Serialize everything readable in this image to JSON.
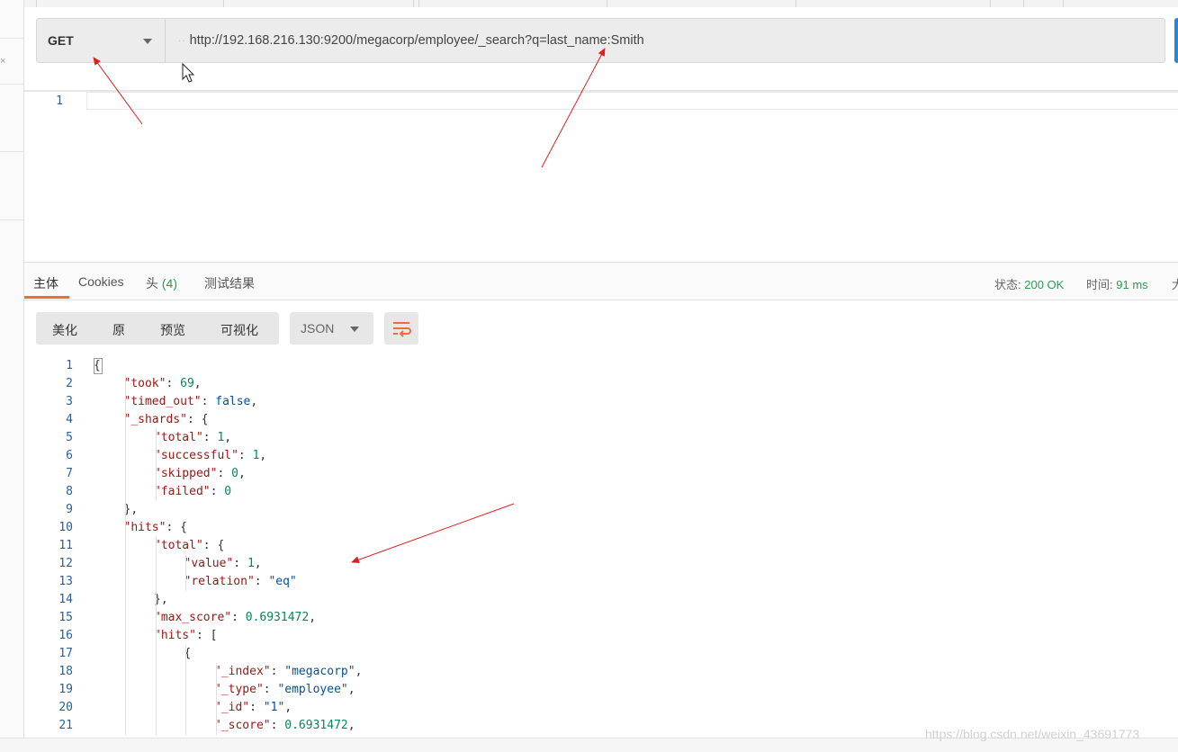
{
  "request": {
    "method": "GET",
    "url": "http://192.168.216.130:9200/megacorp/employee/_search?q=last_name:Smith"
  },
  "editor": {
    "line_numbers": [
      "1"
    ]
  },
  "response_tabs": {
    "body": "主体",
    "cookies": "Cookies",
    "headers": "头",
    "headers_count": "(4)",
    "tests": "测试结果"
  },
  "status": {
    "status_label": "状态:",
    "status_value": "200 OK",
    "time_label": "时间:",
    "time_value": "91 ms",
    "size_label": "大"
  },
  "format_toolbar": {
    "pretty": "美化",
    "raw": "原",
    "preview": "预览",
    "visualize": "可视化",
    "language": "JSON"
  },
  "code_lines": [
    {
      "n": "1",
      "indent": 0,
      "parts": [
        [
          "p",
          "{"
        ]
      ]
    },
    {
      "n": "2",
      "indent": 1,
      "parts": [
        [
          "k",
          "\"took\""
        ],
        [
          "p",
          ": "
        ],
        [
          "n",
          "69"
        ],
        [
          "p",
          ","
        ]
      ]
    },
    {
      "n": "3",
      "indent": 1,
      "parts": [
        [
          "k",
          "\"timed_out\""
        ],
        [
          "p",
          ": "
        ],
        [
          "b",
          "false"
        ],
        [
          "p",
          ","
        ]
      ]
    },
    {
      "n": "4",
      "indent": 1,
      "parts": [
        [
          "k",
          "\"_shards\""
        ],
        [
          "p",
          ": {"
        ]
      ]
    },
    {
      "n": "5",
      "indent": 2,
      "parts": [
        [
          "k",
          "\"total\""
        ],
        [
          "p",
          ": "
        ],
        [
          "n",
          "1"
        ],
        [
          "p",
          ","
        ]
      ]
    },
    {
      "n": "6",
      "indent": 2,
      "parts": [
        [
          "k",
          "\"successful\""
        ],
        [
          "p",
          ": "
        ],
        [
          "n",
          "1"
        ],
        [
          "p",
          ","
        ]
      ]
    },
    {
      "n": "7",
      "indent": 2,
      "parts": [
        [
          "k",
          "\"skipped\""
        ],
        [
          "p",
          ": "
        ],
        [
          "n",
          "0"
        ],
        [
          "p",
          ","
        ]
      ]
    },
    {
      "n": "8",
      "indent": 2,
      "parts": [
        [
          "k",
          "\"failed\""
        ],
        [
          "p",
          ": "
        ],
        [
          "n",
          "0"
        ]
      ]
    },
    {
      "n": "9",
      "indent": 1,
      "parts": [
        [
          "p",
          "},"
        ]
      ]
    },
    {
      "n": "10",
      "indent": 1,
      "parts": [
        [
          "k",
          "\"hits\""
        ],
        [
          "p",
          ": {"
        ]
      ]
    },
    {
      "n": "11",
      "indent": 2,
      "parts": [
        [
          "k",
          "\"total\""
        ],
        [
          "p",
          ": {"
        ]
      ]
    },
    {
      "n": "12",
      "indent": 3,
      "parts": [
        [
          "k",
          "\"value\""
        ],
        [
          "p",
          ": "
        ],
        [
          "n",
          "1"
        ],
        [
          "p",
          ","
        ]
      ]
    },
    {
      "n": "13",
      "indent": 3,
      "parts": [
        [
          "k",
          "\"relation\""
        ],
        [
          "p",
          ": "
        ],
        [
          "s",
          "\"eq\""
        ]
      ]
    },
    {
      "n": "14",
      "indent": 2,
      "parts": [
        [
          "p",
          "},"
        ]
      ]
    },
    {
      "n": "15",
      "indent": 2,
      "parts": [
        [
          "k",
          "\"max_score\""
        ],
        [
          "p",
          ": "
        ],
        [
          "n",
          "0.6931472"
        ],
        [
          "p",
          ","
        ]
      ]
    },
    {
      "n": "16",
      "indent": 2,
      "parts": [
        [
          "k",
          "\"hits\""
        ],
        [
          "p",
          ": ["
        ]
      ]
    },
    {
      "n": "17",
      "indent": 3,
      "parts": [
        [
          "p",
          "{"
        ]
      ]
    },
    {
      "n": "18",
      "indent": 4,
      "parts": [
        [
          "k",
          "\"_index\""
        ],
        [
          "p",
          ": "
        ],
        [
          "s",
          "\"megacorp\""
        ],
        [
          "p",
          ","
        ]
      ]
    },
    {
      "n": "19",
      "indent": 4,
      "parts": [
        [
          "k",
          "\"_type\""
        ],
        [
          "p",
          ": "
        ],
        [
          "s",
          "\"employee\""
        ],
        [
          "p",
          ","
        ]
      ]
    },
    {
      "n": "20",
      "indent": 4,
      "parts": [
        [
          "k",
          "\"_id\""
        ],
        [
          "p",
          ": "
        ],
        [
          "s",
          "\"1\""
        ],
        [
          "p",
          ","
        ]
      ]
    },
    {
      "n": "21",
      "indent": 4,
      "parts": [
        [
          "k",
          "\"_score\""
        ],
        [
          "p",
          ": "
        ],
        [
          "n",
          "0.6931472"
        ],
        [
          "p",
          ","
        ]
      ]
    }
  ],
  "watermark": "https://blog.csdn.net/weixin_43691773",
  "colors": {
    "accent_orange": "#f26b3a",
    "status_green": "#2a9d53",
    "annotation_red": "#e02020"
  }
}
